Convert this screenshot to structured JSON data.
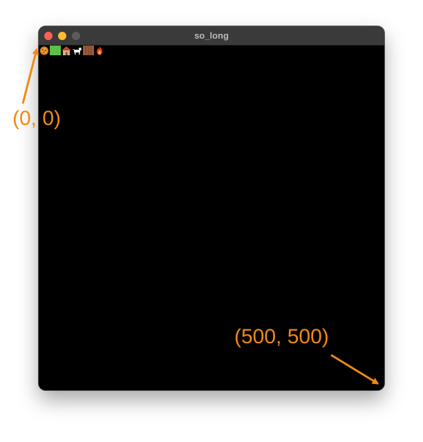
{
  "window": {
    "title": "so_long"
  },
  "sprites": [
    {
      "name": "pizza-sprite",
      "icon": "pizza"
    },
    {
      "name": "grass-sprite",
      "icon": "grass"
    },
    {
      "name": "house-sprite",
      "icon": "house"
    },
    {
      "name": "dog-sprite",
      "icon": "dog"
    },
    {
      "name": "wall-sprite",
      "icon": "wood-wall"
    },
    {
      "name": "fire-sprite",
      "icon": "fire"
    }
  ],
  "annotations": {
    "origin_label": "(0, 0)",
    "end_label": "(500, 500)",
    "color": "#f08a12"
  },
  "colors": {
    "close": "#ff5f57",
    "minimize": "#febc2e",
    "zoom_disabled": "#5b5b5b",
    "canvas": "#000000",
    "titlebar": "#3a3a3a"
  }
}
